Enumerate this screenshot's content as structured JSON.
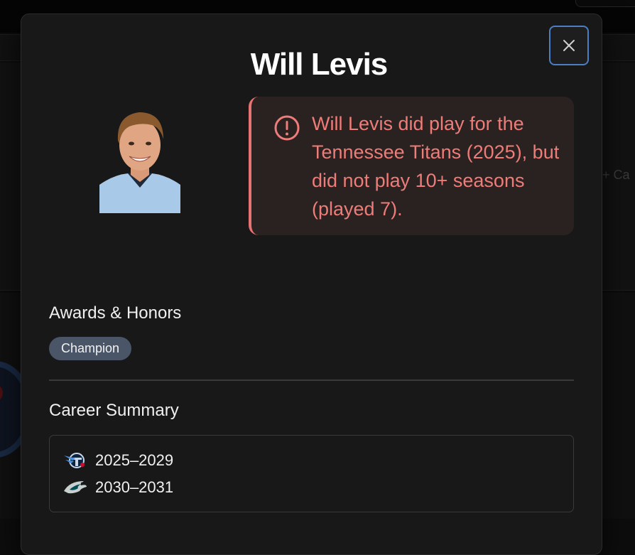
{
  "modal": {
    "title": "Will Levis",
    "close_icon": "close-icon"
  },
  "alert": {
    "icon": "alert-circle-icon",
    "message": "Will Levis did play for the Tennessee Titans (2025), but did not play 10+ seasons (played 7).",
    "color": "#ee7c78"
  },
  "awards": {
    "heading": "Awards & Honors",
    "badges": [
      "Champion"
    ]
  },
  "career": {
    "heading": "Career Summary",
    "stints": [
      {
        "team_icon": "titans-logo-icon",
        "years": "2025–2029"
      },
      {
        "team_icon": "eagles-logo-icon",
        "years": "2030–2031"
      }
    ]
  },
  "background": {
    "partial_text": "+ Ca"
  }
}
